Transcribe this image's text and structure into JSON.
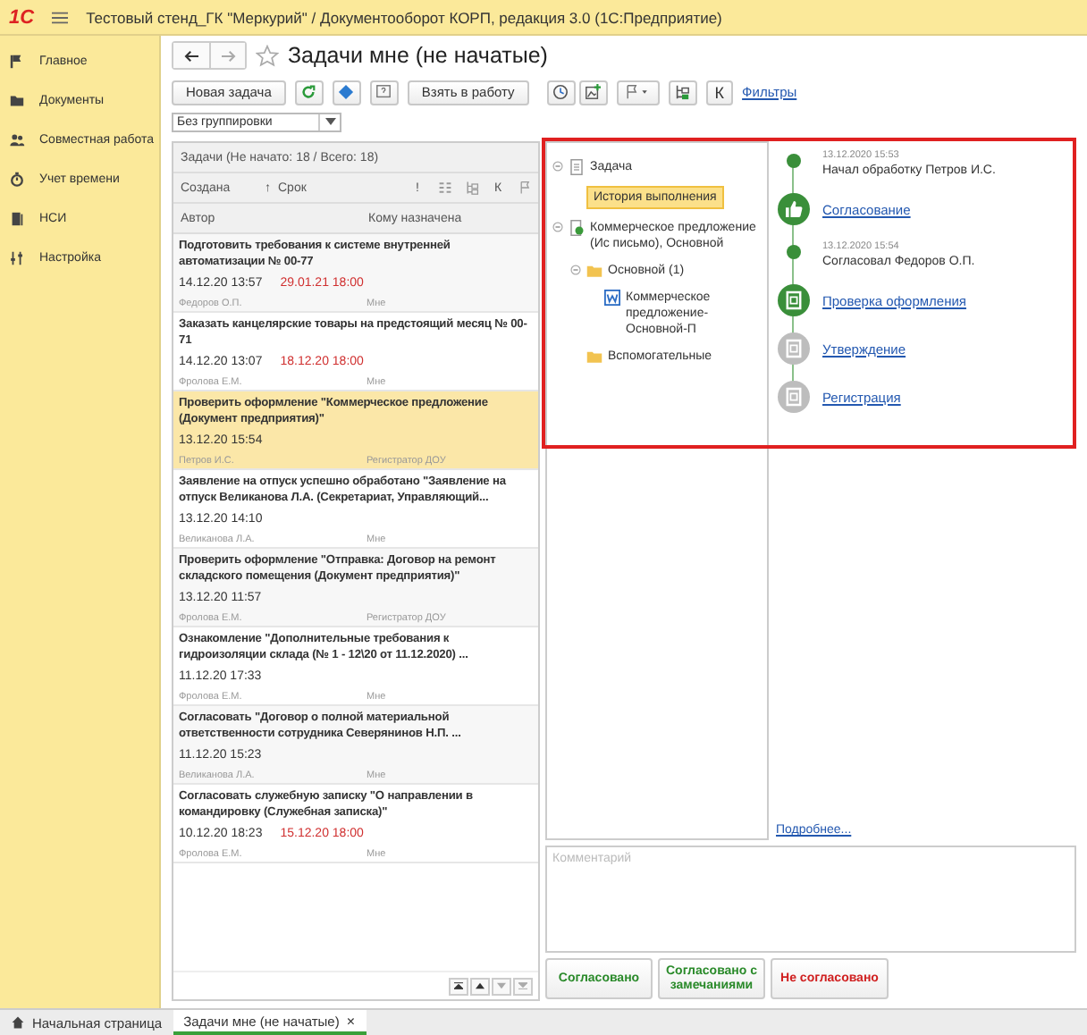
{
  "window": {
    "logo": "1С",
    "title": "Тестовый стенд_ГК \"Меркурий\" / Документооборот КОРП, редакция 3.0  (1С:Предприятие)"
  },
  "sidebar": {
    "items": [
      {
        "label": "Главное"
      },
      {
        "label": "Документы"
      },
      {
        "label": "Совместная работа"
      },
      {
        "label": "Учет времени"
      },
      {
        "label": "НСИ"
      },
      {
        "label": "Настройка"
      }
    ]
  },
  "page": {
    "title": "Задачи мне (не начатые)",
    "favorite": false
  },
  "toolbar": {
    "new_task": "Новая задача",
    "take": "Взять в работу",
    "k": "К",
    "filters": "Фильтры"
  },
  "grouping": {
    "value": "Без группировки"
  },
  "task_list": {
    "header": "Задачи (Не начато: 18 / Всего: 18)",
    "columns": {
      "created": "Создана",
      "sort": "↑",
      "deadline": "Срок",
      "important": "!",
      "k": "К",
      "author": "Автор",
      "assignee": "Кому назначена"
    },
    "rows": [
      {
        "title": "Подготовить требования к системе внутренней автоматизации № 00-77",
        "created": "14.12.20 13:57",
        "deadline": "29.01.21 18:00",
        "author": "Федоров О.П.",
        "assignee": "Мне",
        "selected": false
      },
      {
        "title": "Заказать канцелярские товары на предстоящий месяц № 00-71",
        "created": "14.12.20 13:07",
        "deadline": "18.12.20 18:00",
        "author": "Фролова Е.М.",
        "assignee": "Мне",
        "selected": false
      },
      {
        "title": "Проверить оформление \"Коммерческое предложение (Документ предприятия)\"",
        "created": "13.12.20 15:54",
        "author": "Петров И.С.",
        "assignee": "Регистратор ДОУ",
        "selected": true
      },
      {
        "title": "Заявление на отпуск успешно обработано \"Заявление на отпуск Великанова Л.А. (Секретариат, Управляющий...",
        "created": "13.12.20 14:10",
        "author": "Великанова Л.А.",
        "assignee": "Мне",
        "selected": false
      },
      {
        "title": "Проверить оформление \"Отправка: Договор на ремонт складского помещения (Документ предприятия)\"",
        "created": "13.12.20 11:57",
        "author": "Фролова Е.М.",
        "assignee": "Регистратор ДОУ",
        "selected": false
      },
      {
        "title": "Ознакомление \"Дополнительные требования к гидроизоляции склада (№ 1 - 12\\20 от 11.12.2020) ...",
        "created": "11.12.20 17:33",
        "author": "Фролова Е.М.",
        "assignee": "Мне",
        "selected": false
      },
      {
        "title": "Согласовать \"Договор о полной материальной ответственности сотрудника Северянинов Н.П. ...",
        "created": "11.12.20 15:23",
        "author": "Великанова Л.А.",
        "assignee": "Мне",
        "selected": false
      },
      {
        "title": "Согласовать служебную записку \"О направлении в командировку (Служебная записка)\"",
        "created": "10.12.20 18:23",
        "deadline": "15.12.20 18:00",
        "author": "Фролова Е.М.",
        "assignee": "Мне",
        "selected": false
      }
    ]
  },
  "tree": [
    {
      "kind": "task",
      "label": "Задача",
      "expanded": true,
      "children": [
        {
          "kind": "action",
          "label": "История выполнения",
          "selected": true
        }
      ]
    },
    {
      "kind": "document",
      "label": "Коммерческое предложение (Ис письмо), Основной",
      "expanded": true,
      "children": [
        {
          "kind": "folder",
          "label": "Основной (1)",
          "expanded": true,
          "children": [
            {
              "kind": "file",
              "label": "Коммерческое предложение-Основной-П"
            }
          ]
        },
        {
          "kind": "folder",
          "label": "Вспомогательные"
        }
      ]
    }
  ],
  "timeline": [
    {
      "kind": "event",
      "date": "13.12.2020 15:53",
      "text": "Начал обработку Петров И.С."
    },
    {
      "kind": "approval",
      "label": "Согласование",
      "done": true
    },
    {
      "kind": "event",
      "date": "13.12.2020 15:54",
      "text": "Согласовал Федоров О.П."
    },
    {
      "kind": "check",
      "label": "Проверка оформления",
      "done": true
    },
    {
      "kind": "check",
      "label": "Утверждение",
      "done": false
    },
    {
      "kind": "check",
      "label": "Регистрация",
      "done": false
    }
  ],
  "more_link": "Подробнее...",
  "comment": {
    "placeholder": "Комментарий"
  },
  "actions": [
    {
      "label": "Согласовано",
      "kind": "positive"
    },
    {
      "label": "Согласовано с замечаниями",
      "kind": "positive"
    },
    {
      "label": "Не согласовано",
      "kind": "negative"
    }
  ],
  "bottom_tabs": [
    {
      "label": "Начальная страница",
      "kind": "home",
      "selected": false
    },
    {
      "label": "Задачи мне (не начатые)",
      "kind": "page",
      "selected": true,
      "close": "×"
    }
  ]
}
